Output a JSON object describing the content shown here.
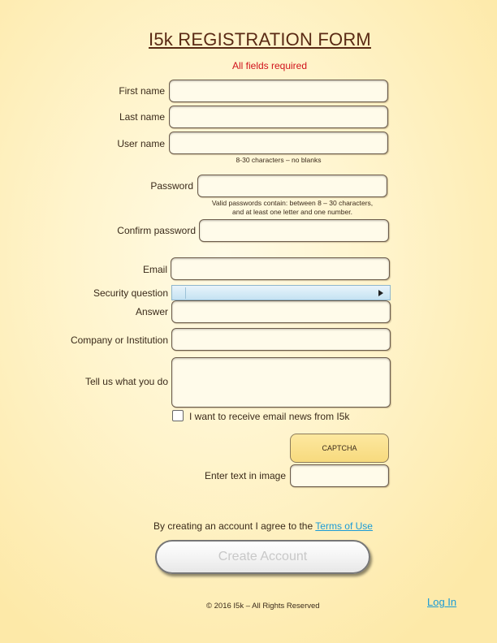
{
  "form": {
    "title": "I5k REGISTRATION FORM",
    "required_note": "All fields required",
    "fields": {
      "first_name": {
        "label": "First name",
        "value": ""
      },
      "last_name": {
        "label": "Last name",
        "value": ""
      },
      "user_name": {
        "label": "User name",
        "value": "",
        "hint": "8-30 characters – no blanks"
      },
      "password": {
        "label": "Password",
        "value": "",
        "hint_line1": "Valid passwords contain: between 8 – 30 characters,",
        "hint_line2": "and at least one letter and one number."
      },
      "confirm_password": {
        "label": "Confirm password",
        "value": ""
      },
      "email": {
        "label": "Email",
        "value": ""
      },
      "security_question": {
        "label": "Security question",
        "selected": ""
      },
      "answer": {
        "label": "Answer",
        "value": ""
      },
      "company": {
        "label": "Company or Institution",
        "value": ""
      },
      "tell_us": {
        "label": "Tell us what you do",
        "value": ""
      }
    },
    "newsletter": {
      "label": "I want to receive email news from I5k",
      "checked": false
    },
    "captcha": {
      "image_text": "CAPTCHA",
      "label": "Enter text in image",
      "value": ""
    },
    "agreement": {
      "text": "By creating an account I agree to the",
      "link": "Terms of Use"
    },
    "create_button": "Create Account"
  },
  "footer": {
    "copyright": "© 2016 I5k – All Rights Reserved",
    "login_link": "Log In"
  },
  "colors": {
    "title": "#5a2a14",
    "required": "#d0121b",
    "link": "#1a9bd6",
    "field_bg": "#fffbea",
    "captcha_bg": "#f7da7e",
    "page_bg": "#fff4cc"
  },
  "icons": {
    "select_arrow": "triangle-right-icon"
  }
}
